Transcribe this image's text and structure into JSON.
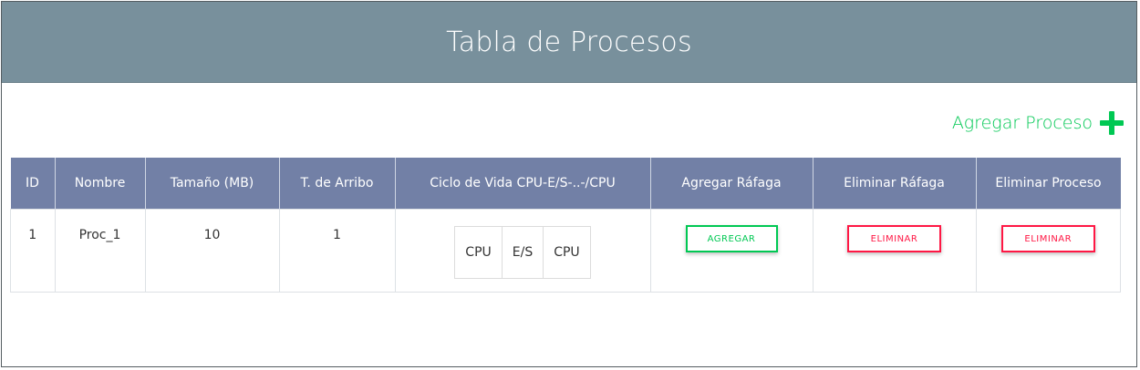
{
  "header": {
    "title": "Tabla de Procesos"
  },
  "actions": {
    "add_process_label": "Agregar Proceso",
    "add_icon": "plus-icon",
    "add_color": "#00c853"
  },
  "table": {
    "columns": [
      "ID",
      "Nombre",
      "Tamaño (MB)",
      "T. de Arribo",
      "Ciclo de Vida CPU-E/S-..-/CPU",
      "Agregar Ráfaga",
      "Eliminar Ráfaga",
      "Eliminar Proceso"
    ],
    "rows": [
      {
        "id": "1",
        "name": "Proc_1",
        "size": "10",
        "arrival": "1",
        "cycle": [
          "CPU",
          "E/S",
          "CPU"
        ],
        "add_burst_label": "AGREGAR",
        "delete_burst_label": "ELIMINAR",
        "delete_process_label": "ELIMINAR"
      }
    ]
  },
  "colors": {
    "header_bg": "#78909c",
    "table_header_bg": "#7280a6",
    "accent_green": "#00c853",
    "accent_red": "#ff1744"
  }
}
